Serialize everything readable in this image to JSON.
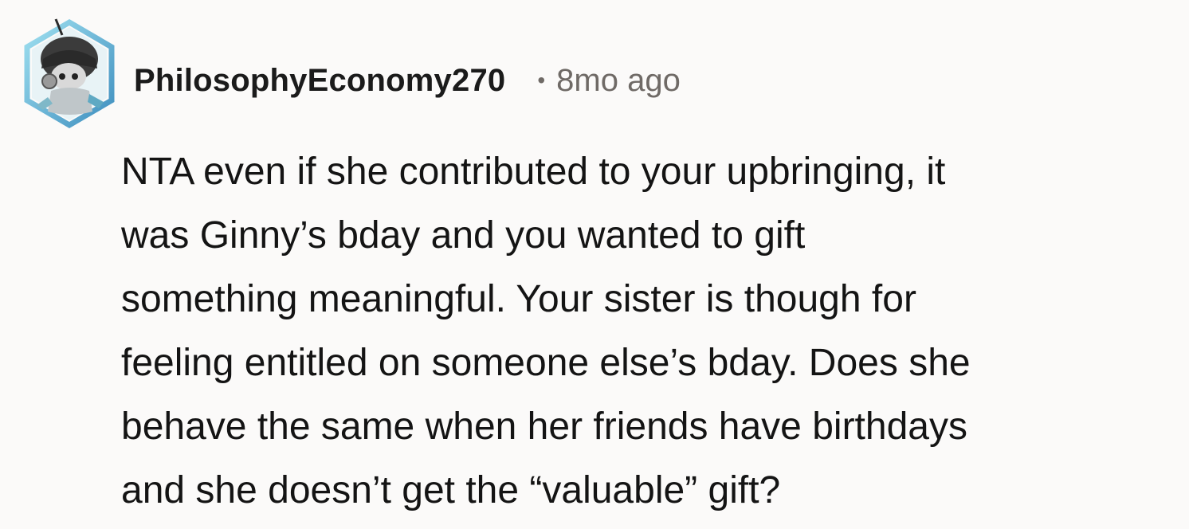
{
  "comment": {
    "username": "PhilosophyEconomy270",
    "separator": "•",
    "timestamp": "8mo ago",
    "avatar_icon": "snoo-avatar-icon",
    "body": "NTA even if she contributed to your upbringing, it\nwas Ginny’s bday and you wanted to gift\nsomething meaningful. Your sister is though for\nfeeling entitled on someone else’s bday. Does she\nbehave the same when her friends have birthdays\nand she doesn’t get the “valuable” gift?"
  },
  "colors": {
    "background": "#fbfaf9",
    "username": "#1b1b1b",
    "meta": "#6f6a66",
    "body": "#141414",
    "avatar_frame": "#5aa7c9"
  }
}
